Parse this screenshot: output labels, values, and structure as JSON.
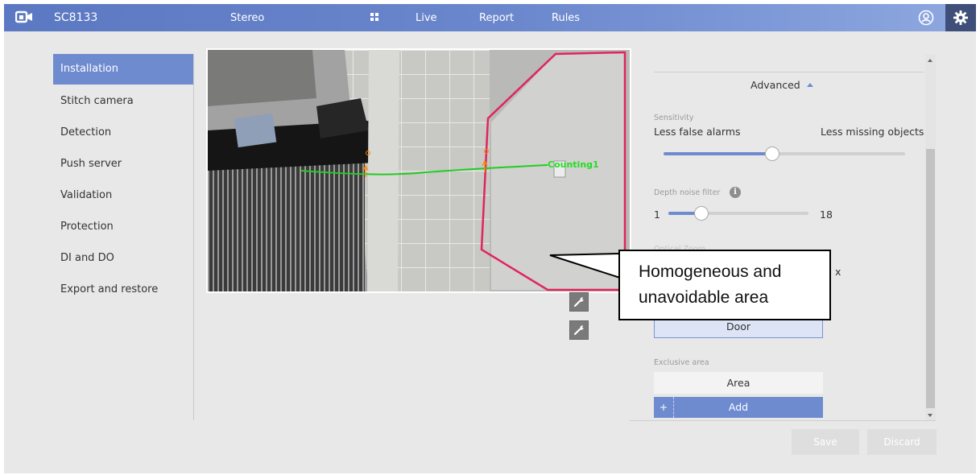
{
  "header": {
    "model": "SC8133",
    "nav": [
      "Stereo",
      "Live",
      "Report",
      "Rules"
    ],
    "icons": [
      "camera-logo-icon",
      "grid-icon",
      "user-icon",
      "gear-icon"
    ]
  },
  "sidebar": {
    "items": [
      {
        "label": "Installation",
        "active": true
      },
      {
        "label": "Stitch camera"
      },
      {
        "label": "Detection"
      },
      {
        "label": "Push server"
      },
      {
        "label": "Validation"
      },
      {
        "label": "Protection"
      },
      {
        "label": "DI and DO"
      },
      {
        "label": "Export and restore"
      }
    ]
  },
  "video": {
    "counting_label": "Counting1"
  },
  "callout": {
    "text": "Homogeneous and\nunavoidable area"
  },
  "panel": {
    "advanced_label": "Advanced",
    "sensitivity": {
      "label": "Sensitivity",
      "left": "Less false alarms",
      "right": "Less missing objects",
      "level": 0.45
    },
    "depth_noise": {
      "label": "Depth noise filter",
      "min": "1",
      "max": "18",
      "level": 0.22
    },
    "optical_zoom": {
      "label": "Optical Zoom",
      "suffix": "x"
    },
    "door_button": "Door",
    "exclusive_area": {
      "label": "Exclusive area",
      "area_button": "Area",
      "add_button": "Add",
      "plus": "+"
    }
  },
  "footer": {
    "save": "Save",
    "discard": "Discard"
  },
  "colors": {
    "accent": "#6f8bd0",
    "header_dark": "#3f4f7a",
    "region_outline": "#e0245e",
    "counting_line": "#22cc22"
  }
}
